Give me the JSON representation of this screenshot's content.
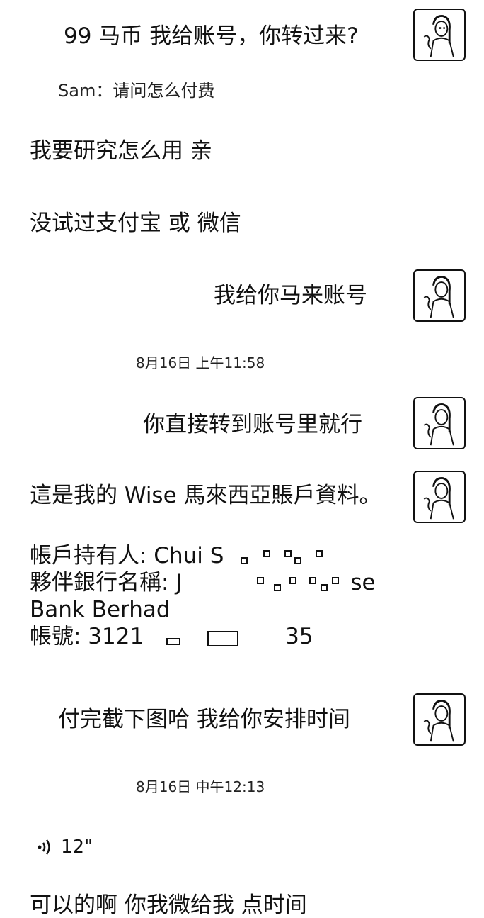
{
  "messages": [
    {
      "text": "99 马币  我给账号，你转过来?"
    },
    {
      "text": "Sam：请问怎么付费"
    },
    {
      "text": "我要研究怎么用 亲"
    },
    {
      "text": "没试过支付宝 或 微信"
    },
    {
      "text": "我给你马来账号"
    },
    {
      "text": "8月16日 上午11:58"
    },
    {
      "text": "你直接转到账号里就行"
    },
    {
      "text": "這是我的 Wise 馬來西亞賬戶資料。"
    },
    {
      "text": "帳戶持有人: Chui S"
    },
    {
      "text": "夥伴銀行名稱: J"
    },
    {
      "text": "se"
    },
    {
      "text": "Bank Berhad"
    },
    {
      "text": "帳號: 3121"
    },
    {
      "text": "35"
    },
    {
      "text": "付完截下图哈  我给你安排时间"
    },
    {
      "text": "8月16日 中午12:13"
    },
    {
      "text": "12\""
    },
    {
      "text": "可以的啊   你我微给我   点时间"
    }
  ],
  "icons": {
    "avatar": "avatar-photo-icon",
    "voice": "voice-wave-icon"
  },
  "colors": {
    "text": "#111111",
    "background": "#ffffff"
  }
}
